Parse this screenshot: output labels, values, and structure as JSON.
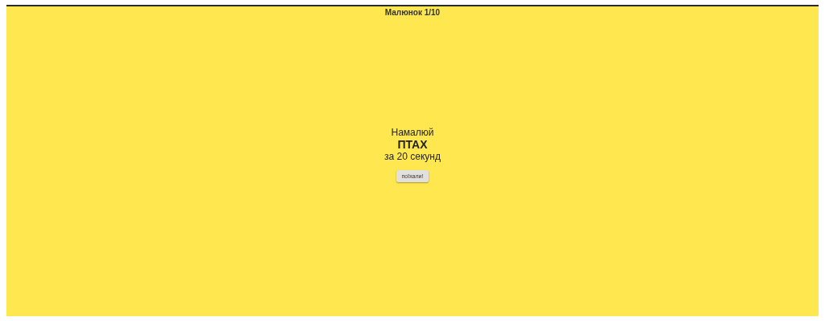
{
  "header": {
    "title": "Малюнок 1/10"
  },
  "prompt": {
    "intro": "Намалюй",
    "subject": "ПТАХ",
    "time_limit": "за 20 секунд"
  },
  "start_button": {
    "label": "поїхали!"
  }
}
